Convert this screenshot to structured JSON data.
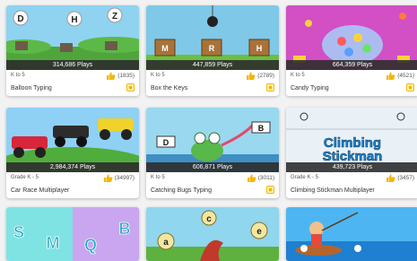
{
  "games": [
    {
      "grade": "K to 5",
      "likes": "(1835)",
      "plays": "314,686 Plays",
      "title": "Balloon Typing"
    },
    {
      "grade": "K to 5",
      "likes": "(2789)",
      "plays": "447,859 Plays",
      "title": "Box the Keys"
    },
    {
      "grade": "K to 5",
      "likes": "(4521)",
      "plays": "664,359 Plays",
      "title": "Candy Typing"
    },
    {
      "grade": "Grade K - 5",
      "likes": "(34997)",
      "plays": "2,984,374 Plays",
      "title": "Car Race Multiplayer"
    },
    {
      "grade": "K to 5",
      "likes": "(3011)",
      "plays": "606,871 Plays",
      "title": "Catching Bugs Typing"
    },
    {
      "grade": "Grade K - 5",
      "likes": "(3457)",
      "plays": "439,723 Plays",
      "title": "Climbing Stickman Multiplayer"
    },
    {},
    {},
    {}
  ],
  "thumb_text": {
    "balloon_letters": [
      "D",
      "H",
      "Z"
    ],
    "box_letters": [
      "M",
      "R",
      "H"
    ],
    "bug_letters": [
      "D",
      "B"
    ],
    "climbing_line1": "Climbing",
    "climbing_line2": "Stickman",
    "letter_tiles": [
      "S",
      "M",
      "Q",
      "B"
    ],
    "bubble_letters": [
      "c",
      "a",
      "e"
    ]
  },
  "icons": {
    "like": "thumbs-up-icon",
    "fav": "favorite-badge-icon"
  },
  "colors": {
    "like": "#f2b705",
    "plays_bar": "#2d2d2d"
  }
}
